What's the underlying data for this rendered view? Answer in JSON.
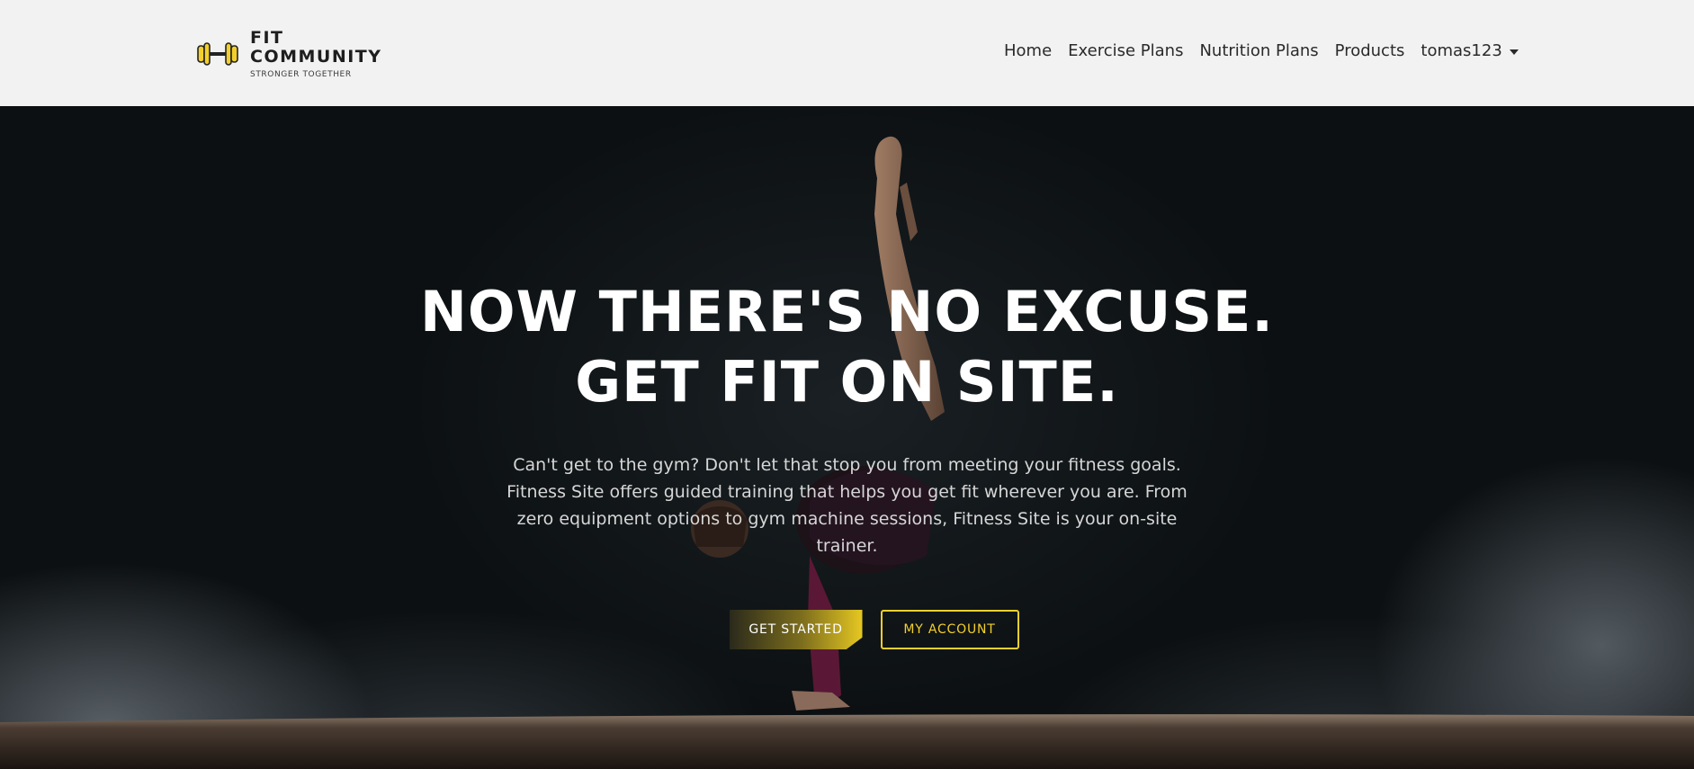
{
  "brand": {
    "title_line1": "FIT",
    "title_line2": "COMMUNITY",
    "tagline": "STRONGER TOGETHER",
    "icon": "dumbbell-icon",
    "accent_color": "#f2cf2d"
  },
  "nav": {
    "items": [
      {
        "label": "Home"
      },
      {
        "label": "Exercise Plans"
      },
      {
        "label": "Nutrition Plans"
      },
      {
        "label": "Products"
      }
    ],
    "user": {
      "label": "tomas123",
      "icon": "caret-down-icon"
    }
  },
  "hero": {
    "headline_line1": "NOW THERE'S NO EXCUSE.",
    "headline_line2": "GET FIT ON SITE.",
    "subtext": "Can't get to the gym? Don't let that stop you from meeting your fitness goals. Fitness Site offers guided training that helps you get fit wherever you are. From zero equipment options to gym machine sessions, Fitness Site is your on-site trainer.",
    "primary_button": "GET STARTED",
    "secondary_button": "MY ACCOUNT"
  }
}
